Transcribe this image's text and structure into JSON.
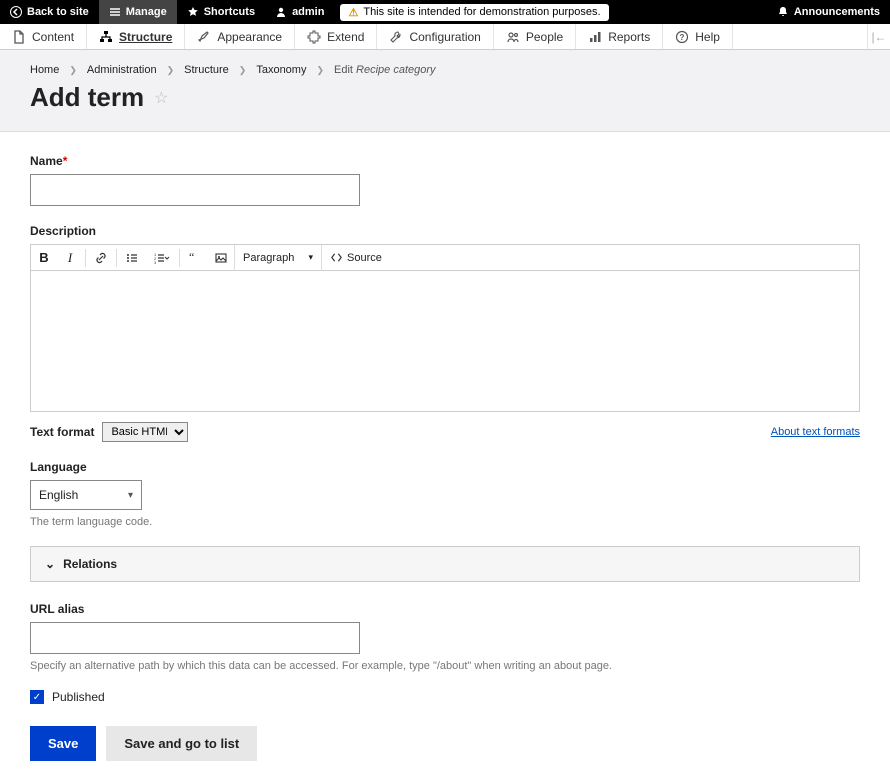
{
  "topbar": {
    "back": "Back to site",
    "manage": "Manage",
    "shortcuts": "Shortcuts",
    "user": "admin",
    "demo_banner": "This site is intended for demonstration purposes.",
    "announcements": "Announcements"
  },
  "tabs": {
    "content": "Content",
    "structure": "Structure",
    "appearance": "Appearance",
    "extend": "Extend",
    "configuration": "Configuration",
    "people": "People",
    "reports": "Reports",
    "help": "Help"
  },
  "breadcrumbs": {
    "home": "Home",
    "administration": "Administration",
    "structure": "Structure",
    "taxonomy": "Taxonomy",
    "edit_prefix": "Edit ",
    "edit_item": "Recipe category"
  },
  "page_title": "Add term",
  "form": {
    "name_label": "Name",
    "description_label": "Description",
    "heading_dropdown": "Paragraph",
    "source_label": "Source",
    "text_format_label": "Text format",
    "text_format_value": "Basic HTML",
    "about_formats": "About text formats",
    "language_label": "Language",
    "language_value": "English",
    "language_help": "The term language code.",
    "relations_label": "Relations",
    "url_alias_label": "URL alias",
    "url_alias_help": "Specify an alternative path by which this data can be accessed. For example, type \"/about\" when writing an about page.",
    "published_label": "Published"
  },
  "actions": {
    "save": "Save",
    "save_list": "Save and go to list"
  }
}
